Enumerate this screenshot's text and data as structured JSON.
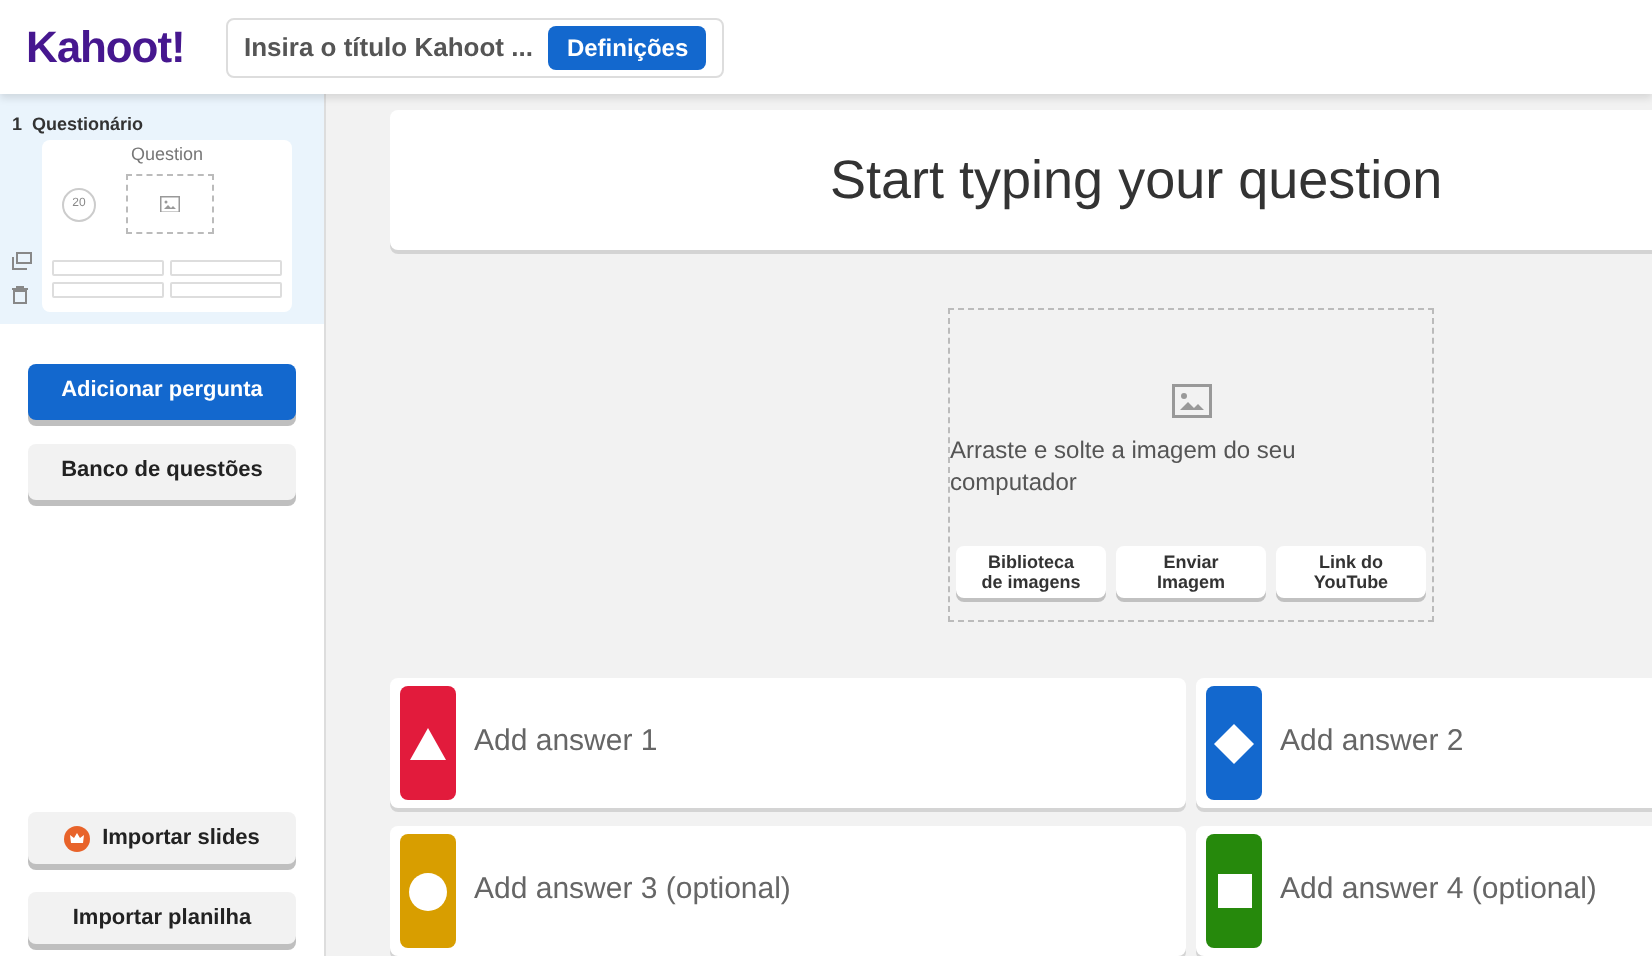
{
  "header": {
    "logo": "Kahoot!",
    "title_placeholder": "Insira o título Kahoot ...",
    "settings_button": "Definições"
  },
  "sidebar": {
    "slides": [
      {
        "number": "1",
        "type": "Questionário",
        "preview_title": "Question",
        "preview_timer": "20",
        "selected": true
      }
    ],
    "buttons": [
      {
        "label": "Adicionar pergunta",
        "kind": "primary"
      },
      {
        "label": "Banco de questões",
        "kind": "secondary"
      }
    ],
    "bottom_buttons": [
      {
        "label": "Importar slides",
        "kind": "icon"
      },
      {
        "label": "Importar planilha",
        "kind": "plain"
      }
    ]
  },
  "question": {
    "placeholder": "Start typing your question"
  },
  "media": {
    "hint": "Arraste e solte a imagem do seu computador",
    "buttons": [
      "Biblioteca de imagens",
      "Enviar Imagem",
      "Link do YouTube"
    ]
  },
  "answers": [
    {
      "placeholder": "Add answer 1",
      "kind": "triangle",
      "color": "#e21b3c"
    },
    {
      "placeholder": "Add answer 2",
      "kind": "diamond",
      "color": "#1368ce"
    },
    {
      "placeholder": "Add answer 3 (optional)",
      "kind": "circle",
      "color": "#d89e00"
    },
    {
      "placeholder": "Add answer 4 (optional)",
      "kind": "square",
      "color": "#26890c"
    }
  ]
}
